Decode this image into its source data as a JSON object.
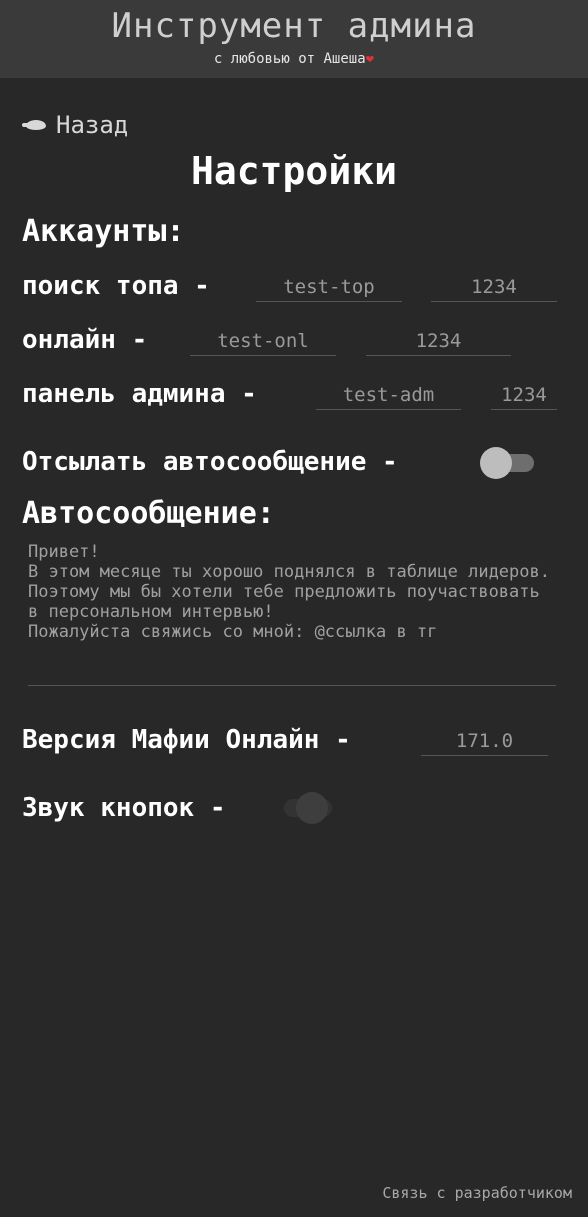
{
  "header": {
    "title": "Инструмент админа",
    "subtitle": "с любовью от Ашеша",
    "heart": "❤"
  },
  "nav": {
    "back_label": "Назад"
  },
  "page": {
    "title": "Настройки"
  },
  "accounts": {
    "section_title": "Аккаунты:",
    "rows": [
      {
        "label": "поиск топа -",
        "login": "test-top",
        "password": "1234"
      },
      {
        "label": "онлайн -",
        "login": "test-onl",
        "password": "1234"
      },
      {
        "label": "панель админа -",
        "login": "test-adm",
        "password": "1234"
      }
    ]
  },
  "auto_message": {
    "toggle_label": "Отсылать автосообщение -",
    "toggle_on": false,
    "section_title": "Автосообщение:",
    "text": "Привет!\nВ этом месяце ты хорошо поднялся в таблице лидеров. Поэтому мы бы хотели тебе предложить поучаствовать в персональном интервью!\nПожалуйста свяжись со мной: @ссылка в тг"
  },
  "version": {
    "label": "Версия Мафии Онлайн -",
    "value": "171.0"
  },
  "sound": {
    "label": "Звук кнопок -",
    "toggle_on": false
  },
  "footer": {
    "dev_link": "Связь с разработчиком"
  },
  "colors": {
    "background": "#282828",
    "header": "#3a3a3a",
    "heart": "#e0303a"
  }
}
